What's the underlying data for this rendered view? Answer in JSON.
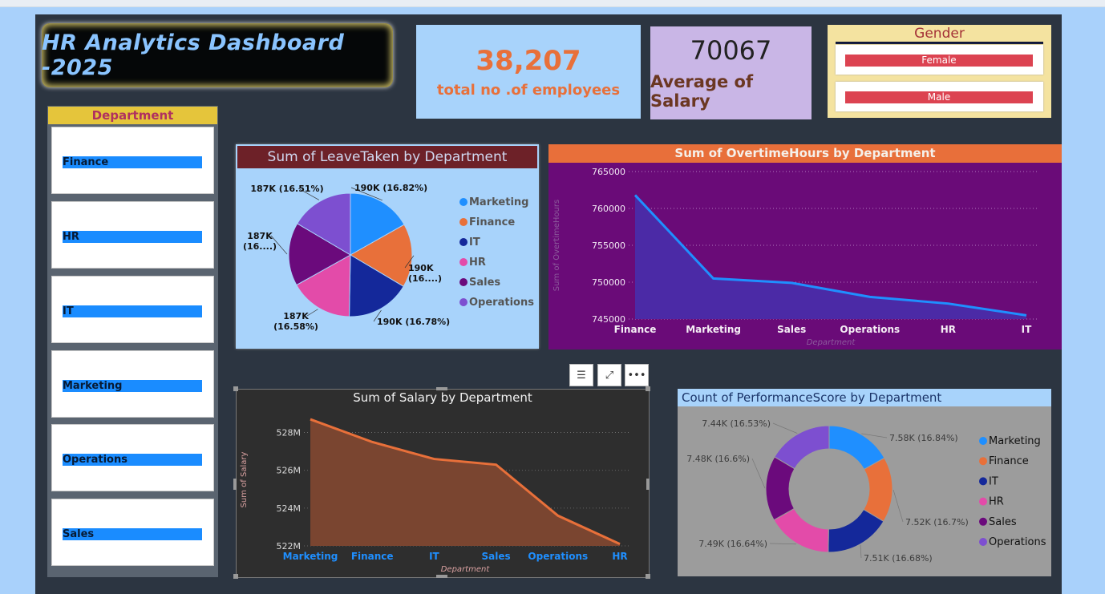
{
  "title": "HR Analytics Dashboard -2025",
  "kpis": {
    "employees_value": "38,207",
    "employees_label": "total no .of employees",
    "salary_value": "70067",
    "salary_label": "Average of Salary"
  },
  "gender": {
    "header": "Gender",
    "options": [
      "Female",
      "Male"
    ]
  },
  "department_slicer": {
    "header": "Department",
    "items": [
      "Finance",
      "HR",
      "IT",
      "Marketing",
      "Operations",
      "Sales"
    ]
  },
  "colors": {
    "Marketing": "#1f8fff",
    "Finance": "#e8703a",
    "IT": "#14289a",
    "HR": "#e34ba9",
    "Sales": "#6b0a7c",
    "Operations": "#7d4fd0"
  },
  "chart_data": [
    {
      "type": "pie",
      "title": "Sum of LeaveTaken by Department",
      "categories": [
        "Marketing",
        "Finance",
        "IT",
        "HR",
        "Sales",
        "Operations"
      ],
      "values": [
        16.82,
        16.7,
        16.78,
        16.58,
        16.6,
        16.51
      ],
      "labels": [
        "190K (16.82%)",
        "190K\n(16....)",
        "190K (16.78%)",
        "187K\n(16.58%)",
        "187K\n(16....)",
        "187K (16.51%)"
      ],
      "legend": [
        "Marketing",
        "Finance",
        "IT",
        "HR",
        "Sales",
        "Operations"
      ]
    },
    {
      "type": "area",
      "title": "Sum of OvertimeHours by Department",
      "xlabel": "Department",
      "ylabel": "Sum of OvertimeHours",
      "categories": [
        "Finance",
        "Marketing",
        "Sales",
        "Operations",
        "HR",
        "IT"
      ],
      "values": [
        761800,
        750500,
        749900,
        748000,
        747100,
        745500
      ],
      "ylim": [
        745000,
        765000
      ],
      "yticks": [
        "765000",
        "760000",
        "755000",
        "750000",
        "745000"
      ]
    },
    {
      "type": "area",
      "title": "Sum of Salary by Department",
      "xlabel": "Department",
      "ylabel": "Sum of Salary",
      "categories": [
        "Marketing",
        "Finance",
        "IT",
        "Sales",
        "Operations",
        "HR"
      ],
      "values": [
        528.7,
        527.5,
        526.6,
        526.3,
        523.6,
        522.1
      ],
      "ylim": [
        522,
        529
      ],
      "yticks": [
        "528M",
        "526M",
        "524M",
        "522M"
      ]
    },
    {
      "type": "pie",
      "subtype": "donut",
      "title": "Count of PerformanceScore by Department",
      "categories": [
        "Marketing",
        "Finance",
        "IT",
        "HR",
        "Sales",
        "Operations"
      ],
      "values": [
        16.84,
        16.7,
        16.68,
        16.64,
        16.6,
        16.53
      ],
      "labels": [
        "7.58K (16.84%)",
        "7.52K (16.7%)",
        "7.51K (16.68%)",
        "7.49K (16.64%)",
        "7.48K (16.6%)",
        "7.44K (16.53%)"
      ],
      "legend": [
        "Marketing",
        "Finance",
        "IT",
        "HR",
        "Sales",
        "Operations"
      ]
    }
  ]
}
